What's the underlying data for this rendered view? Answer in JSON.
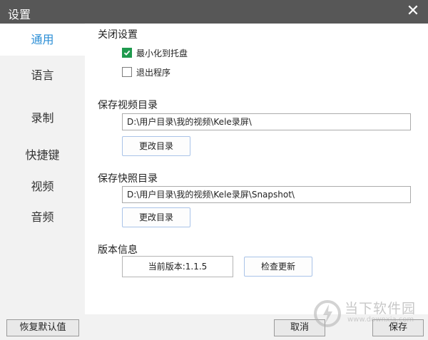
{
  "window": {
    "title": "设置",
    "close_glyph": "✕"
  },
  "sidebar": {
    "items": [
      {
        "label": "通用",
        "active": true
      },
      {
        "label": "语言",
        "active": false
      },
      {
        "label": "录制",
        "active": false
      },
      {
        "label": "快捷键",
        "active": false
      },
      {
        "label": "视频",
        "active": false
      },
      {
        "label": "音频",
        "active": false
      }
    ],
    "restore_defaults_label": "恢复默认值"
  },
  "close_settings": {
    "heading": "关闭设置",
    "minimize_to_tray": {
      "label": "最小化到托盘",
      "checked": true
    },
    "exit_program": {
      "label": "退出程序",
      "checked": false
    }
  },
  "video_dir": {
    "heading": "保存视频目录",
    "path": "D:\\用户目录\\我的视频\\Kele录屏\\",
    "change_label": "更改目录"
  },
  "snapshot_dir": {
    "heading": "保存快照目录",
    "path": "D:\\用户目录\\我的视频\\Kele录屏\\Snapshot\\",
    "change_label": "更改目录"
  },
  "version": {
    "heading": "版本信息",
    "current": "当前版本:1.1.5",
    "check_update_label": "检查更新"
  },
  "footer": {
    "cancel_label": "取消",
    "save_label": "保存"
  },
  "watermark": {
    "text": "当下软件园",
    "url": "www.downxia.com"
  },
  "colors": {
    "titlebar": "#575757",
    "accent": "#2a8ed6",
    "checkbox": "#1f9a4e"
  }
}
